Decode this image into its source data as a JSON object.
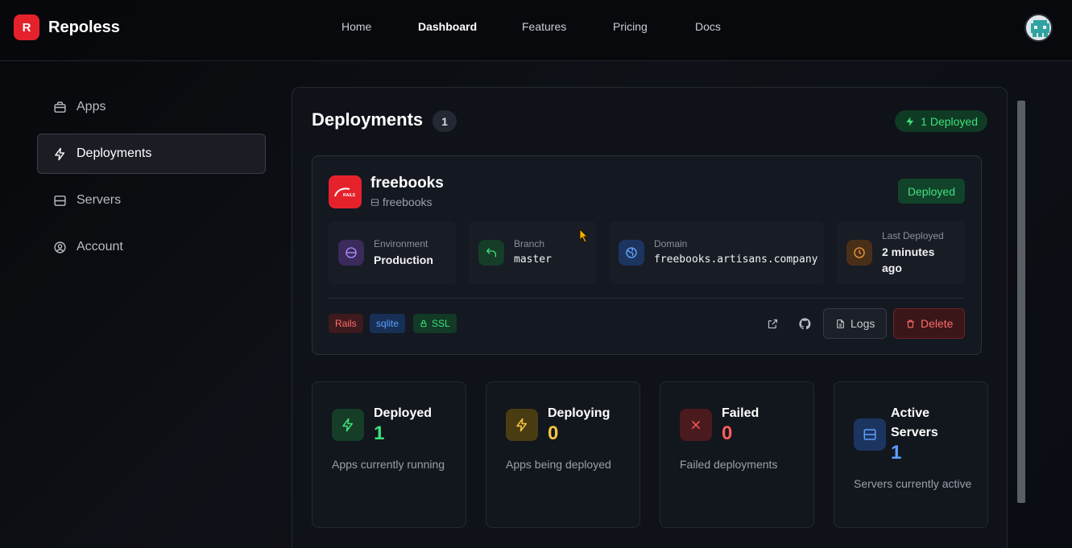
{
  "brand": {
    "logo_letter": "R",
    "name": "Repoless",
    "accent": "#e5222b"
  },
  "nav": {
    "items": [
      "Home",
      "Dashboard",
      "Features",
      "Pricing",
      "Docs"
    ],
    "active": "Dashboard"
  },
  "sidebar": {
    "items": [
      {
        "label": "Apps",
        "icon": "briefcase-icon"
      },
      {
        "label": "Deployments",
        "icon": "lightning-icon",
        "active": true
      },
      {
        "label": "Servers",
        "icon": "server-icon"
      },
      {
        "label": "Account",
        "icon": "user-circle-icon"
      }
    ]
  },
  "deployments": {
    "title": "Deployments",
    "count": "1",
    "deployed_pill": "1 Deployed",
    "app": {
      "name": "freebooks",
      "server": "freebooks",
      "logo_text": "RAILS",
      "status": "Deployed",
      "info": {
        "environment": {
          "label": "Environment",
          "value": "Production"
        },
        "branch": {
          "label": "Branch",
          "value": "master"
        },
        "domain": {
          "label": "Domain",
          "value": "freebooks.artisans.company"
        },
        "last_deployed": {
          "label": "Last Deployed",
          "value_line1": "2 minutes",
          "value_line2": "ago"
        }
      },
      "tags": [
        "Rails",
        "sqlite",
        "SSL"
      ],
      "actions": {
        "logs": "Logs",
        "delete": "Delete"
      }
    }
  },
  "stats": [
    {
      "title": "Deployed",
      "value": "1",
      "desc": "Apps currently running",
      "color": "#3ee07a"
    },
    {
      "title": "Deploying",
      "value": "0",
      "desc": "Apps being deployed",
      "color": "#f5c542"
    },
    {
      "title": "Failed",
      "value": "0",
      "desc": "Failed deployments",
      "color": "#ff5c5c"
    },
    {
      "title": "Active Servers",
      "value": "1",
      "desc": "Servers currently active",
      "color": "#5aa0ff"
    }
  ]
}
